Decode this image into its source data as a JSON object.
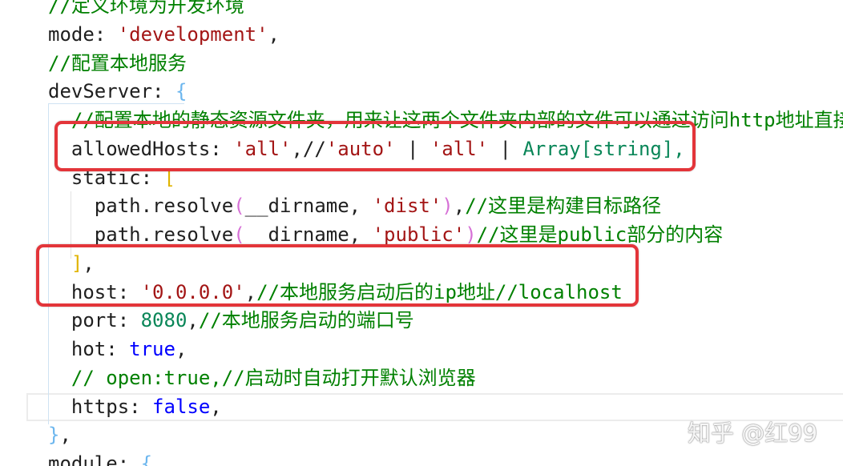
{
  "editor": {
    "lines": [
      [
        "//定义环境为开发环境"
      ],
      [
        "mode: ",
        "'development'",
        ","
      ],
      [
        "//配置本地服务"
      ],
      [
        "devServer: ",
        "{"
      ],
      [
        "//配置本地的静态资源文件夹，用来让这两个文件夹内部的文件可以通过访问http地址直接"
      ],
      [
        "allowedHosts: ",
        "'all'",
        ",//",
        "'auto'",
        " | ",
        "'all'",
        " | ",
        "Array[string],"
      ],
      [
        "static: ",
        "["
      ],
      [
        "path.resolve",
        "(",
        "__dirname, ",
        "'dist'",
        ")",
        ",",
        "//这里是构建目标路径"
      ],
      [
        "path.resolve",
        "(",
        "__dirname, ",
        "'public'",
        ")",
        "//这里是public部分的内容"
      ],
      [
        "]",
        ","
      ],
      [
        "host: ",
        "'0.0.0.0'",
        ",",
        "//本地服务启动后的ip地址//localhost"
      ],
      [
        "port: ",
        "8080",
        ",",
        "//本地服务启动的端口号"
      ],
      [
        "hot: ",
        "true",
        ","
      ],
      [
        "// open:true,//启动时自动打开默认浏览器"
      ],
      [
        "https: ",
        "false",
        ","
      ],
      [
        "}",
        ","
      ],
      [
        "module: ",
        "{"
      ]
    ]
  },
  "watermark": {
    "text": "知乎 @红99"
  },
  "colors": {
    "background": "#ffffff",
    "comment": "#008000",
    "string": "#a31515",
    "number": "#098658",
    "boolean": "#0000ff",
    "brace": "#6cb6ee",
    "square_bracket": "#e0b400",
    "paren": "#d670d6",
    "annotation": "#e3353a"
  }
}
